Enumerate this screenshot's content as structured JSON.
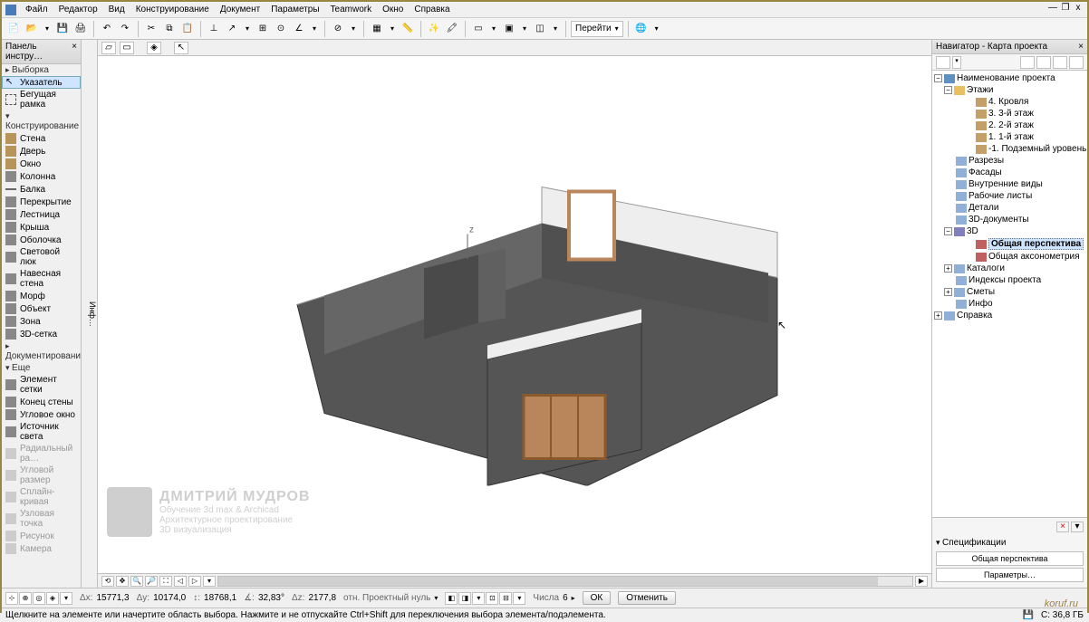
{
  "menu": {
    "items": [
      "Файл",
      "Редактор",
      "Вид",
      "Конструирование",
      "Документ",
      "Параметры",
      "Teamwork",
      "Окно",
      "Справка"
    ]
  },
  "window_controls": {
    "min": "—",
    "restore": "❐",
    "close": "x"
  },
  "toolbox": {
    "title": "Панель инстру…",
    "groups": {
      "selection": {
        "label": "Выборка",
        "items": [
          "Указатель",
          "Бегущая рамка"
        ]
      },
      "construct": {
        "label": "Конструирование",
        "items": [
          "Стена",
          "Дверь",
          "Окно",
          "Колонна",
          "Балка",
          "Перекрытие",
          "Лестница",
          "Крыша",
          "Оболочка",
          "Световой люк",
          "Навесная стена",
          "Морф",
          "Объект",
          "Зона",
          "3D-сетка"
        ]
      },
      "document": {
        "label": "Документирование"
      },
      "more": {
        "label": "Еще",
        "items": [
          "Элемент сетки",
          "Конец стены",
          "Угловое окно",
          "Источник света",
          "Радиальный ра…",
          "Угловой размер",
          "Сплайн-кривая",
          "Узловая точка",
          "Рисунок",
          "Камера"
        ]
      }
    },
    "selected": "Указатель"
  },
  "infobar_label": "Инф…",
  "toolbar_nav_label": "Перейти",
  "navigator": {
    "title": "Навигатор - Карта проекта",
    "root": "Наименование проекта",
    "floors_label": "Этажи",
    "floors": [
      "4. Кровля",
      "3. 3-й этаж",
      "2. 2-й этаж",
      "1. 1-й этаж",
      "-1. Подземный уровень"
    ],
    "sections": [
      "Разрезы",
      "Фасады",
      "Внутренние виды",
      "Рабочие листы",
      "Детали",
      "3D-документы"
    ],
    "d3_label": "3D",
    "d3_items": [
      "Общая перспектива",
      "Общая аксонометрия"
    ],
    "d3_selected": "Общая перспектива",
    "catalogs": [
      "Каталоги",
      "Индексы проекта",
      "Сметы",
      "Инфо"
    ],
    "help": "Справка"
  },
  "spec": {
    "header": "Спецификации",
    "view_name": "Общая перспектива",
    "params_btn": "Параметры…"
  },
  "coords": {
    "dx": "Δx:",
    "dx_v1": "15771,3",
    "dx_v2": "18768,1",
    "dy": "Δy:",
    "dy_v": "10174,0",
    "angle": "∡:",
    "angle_v": "32,83°",
    "dz": "Δz:",
    "dz_v": "2177,8",
    "origin": "отн. Проектный нуль",
    "steps_lbl": "Числа",
    "steps_v": "6",
    "ok": "ОК",
    "cancel": "Отменить"
  },
  "status": {
    "hint": "Щелкните на элементе или начертите область выбора. Нажмите и не отпускайте Ctrl+Shift для переключения выбора элемента/подэлемента.",
    "disk": "C: 36,8 ГБ"
  },
  "watermark": {
    "name": "ДМИТРИЙ МУДРОВ",
    "l2": "Обучение 3d max & Archicad",
    "l3": "Архитектурное проектирование",
    "l4": "3D визуализация"
  },
  "brand": "koruf.ru"
}
